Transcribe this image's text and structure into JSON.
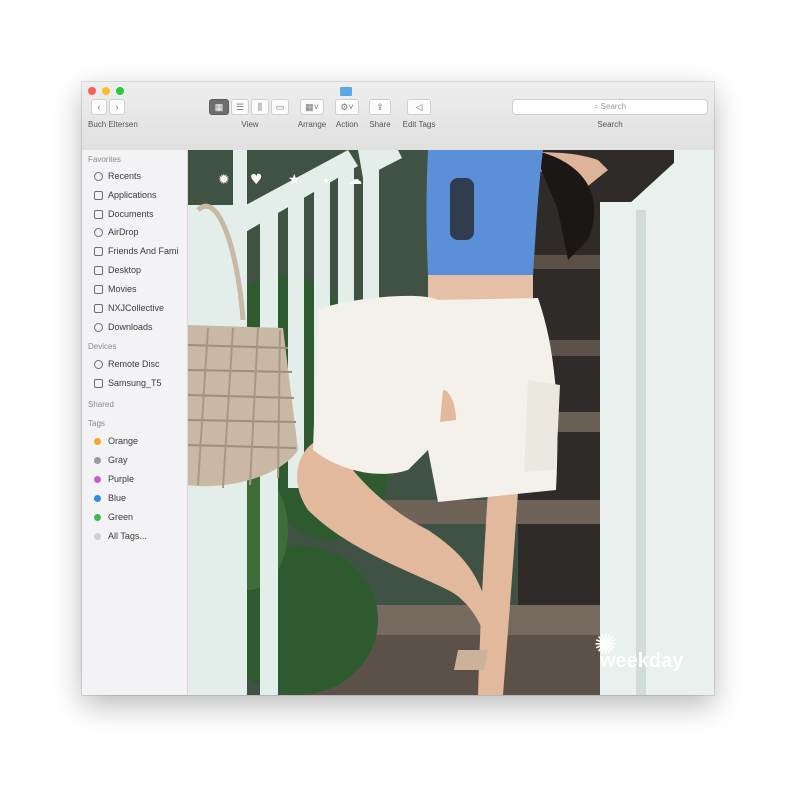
{
  "finder": {
    "window_title": "Buch Eltersen",
    "toolbar": {
      "view": "View",
      "arrange": "Arrange",
      "action": "Action",
      "share": "Share",
      "edit_tags": "Edit Tags",
      "search_label": "Search",
      "search_placeholder": "Search"
    },
    "sidebar": {
      "favorites_header": "Favorites",
      "favorites": [
        "Recents",
        "Applications",
        "Documents",
        "AirDrop",
        "Friends And Fami",
        "Desktop",
        "Movies",
        "NXJCollective",
        "Downloads"
      ],
      "devices_header": "Devices",
      "devices": [
        "Remote Disc",
        "Samsung_T5"
      ],
      "shared_header": "Shared",
      "tags_header": "Tags",
      "tags": [
        {
          "label": "Orange",
          "color": "#f5a623"
        },
        {
          "label": "Gray",
          "color": "#9b9b9b"
        },
        {
          "label": "Purple",
          "color": "#c45cd6"
        },
        {
          "label": "Blue",
          "color": "#2f8ce6"
        },
        {
          "label": "Green",
          "color": "#3dbb4f"
        },
        {
          "label": "All Tags...",
          "color": "#cfcfcf"
        }
      ]
    }
  },
  "content": {
    "watermark": "weekday",
    "flower_icon": "flower-icon"
  },
  "colors": {
    "top_blue": "#5b8fd8",
    "shorts": "#f3f1ea",
    "railing": "#e3eeea",
    "stairs_dark": "#3a3530",
    "foliage": "#2f5a2f",
    "bag": "#c9b8a4"
  }
}
